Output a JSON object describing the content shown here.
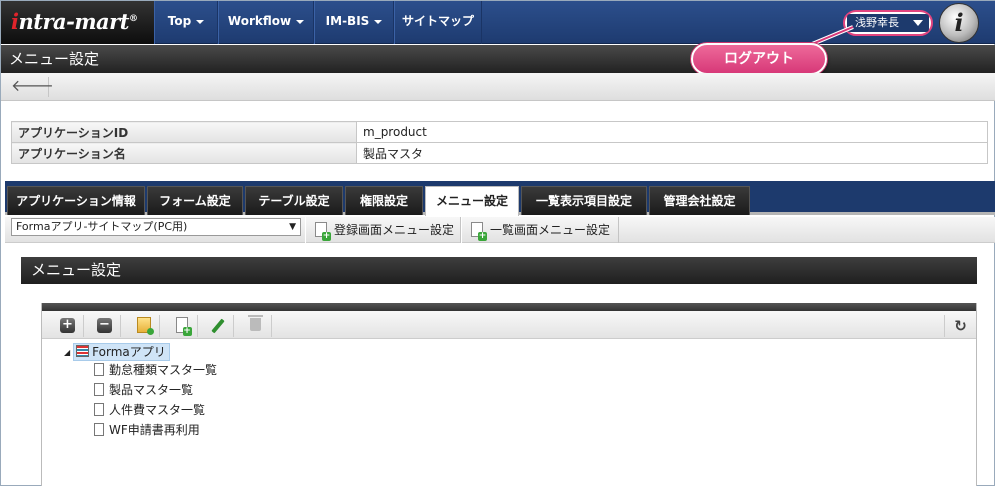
{
  "app": {
    "logo_text": "intra-mart",
    "logo_mark": "®"
  },
  "nav": {
    "items": [
      {
        "label": "Top",
        "dropdown": true
      },
      {
        "label": "Workflow",
        "dropdown": true
      },
      {
        "label": "IM-BIS",
        "dropdown": true
      },
      {
        "label": "サイトマップ",
        "dropdown": false
      }
    ],
    "user_name": "浅野幸長",
    "info_glyph": "i"
  },
  "callout": {
    "label": "ログアウト"
  },
  "page": {
    "title": "メニュー設定",
    "back_glyph": "🡐"
  },
  "app_info": {
    "rows": [
      {
        "label": "アプリケーションID",
        "value": "m_product"
      },
      {
        "label": "アプリケーション名",
        "value": "製品マスタ"
      }
    ]
  },
  "tabs": [
    {
      "label": "アプリケーション情報",
      "active": false
    },
    {
      "label": "フォーム設定",
      "active": false
    },
    {
      "label": "テーブル設定",
      "active": false
    },
    {
      "label": "権限設定",
      "active": false
    },
    {
      "label": "メニュー設定",
      "active": true
    },
    {
      "label": "一覧表示項目設定",
      "active": false
    },
    {
      "label": "管理会社設定",
      "active": false
    }
  ],
  "sub_toolbar": {
    "select_value": "Formaアプリ-サイトマップ(PC用)",
    "buttons": [
      {
        "label": "登録画面メニュー設定"
      },
      {
        "label": "一覧画面メニュー設定"
      }
    ]
  },
  "section": {
    "title": "メニュー設定"
  },
  "tree_toolbar": {
    "icons": [
      "plus-icon",
      "minus-icon",
      "add-folder-icon",
      "add-page-icon",
      "edit-icon",
      "trash-icon"
    ],
    "refresh_glyph": "↻"
  },
  "tree": {
    "root": {
      "label": "Formaアプリ",
      "expanded": true
    },
    "children": [
      {
        "label": "勤怠種類マスタ一覧"
      },
      {
        "label": "製品マスタ一覧"
      },
      {
        "label": "人件費マスタ一覧"
      },
      {
        "label": "WF申請書再利用"
      }
    ]
  }
}
